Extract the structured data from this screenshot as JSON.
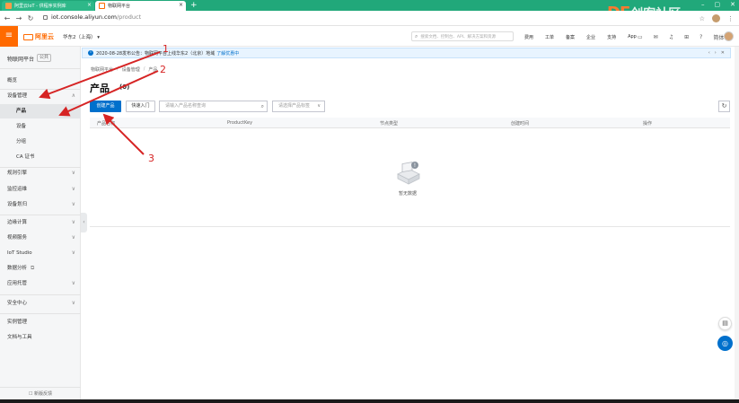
{
  "browser": {
    "tabs": [
      {
        "label": "阿里云IoT - 供程序实例库",
        "active": false
      },
      {
        "label": "物联网平台",
        "active": true
      }
    ],
    "new_tab": "+",
    "url_host": "iot.console.aliyun.com",
    "url_path": "/product"
  },
  "watermark": {
    "brand": "DF",
    "text": "创客社区"
  },
  "topbar": {
    "logo": "阿里云",
    "region": "华东2（上海）",
    "search_placeholder": "搜索文档、控制台、API、解决方案和资源",
    "nav": [
      "费用",
      "工单",
      "备案",
      "企业",
      "支持",
      "App"
    ],
    "user": "简体"
  },
  "sidebar": {
    "title": "物联网平台",
    "badge": "公共",
    "items": [
      {
        "label": "概览",
        "chevron": ""
      },
      {
        "label": "设备管理",
        "chevron": "∧"
      },
      {
        "label": "产品",
        "chevron": ""
      },
      {
        "label": "设备",
        "chevron": ""
      },
      {
        "label": "分组",
        "chevron": ""
      },
      {
        "label": "CA 证书",
        "chevron": ""
      },
      {
        "label": "规则引擎",
        "chevron": "∨"
      },
      {
        "label": "监控运维",
        "chevron": "∨"
      },
      {
        "label": "设备划归",
        "chevron": "∨"
      },
      {
        "label": "边缘计算",
        "chevron": "∨"
      },
      {
        "label": "视频服务",
        "chevron": "∨"
      },
      {
        "label": "IoT Studio",
        "chevron": "∨"
      },
      {
        "label": "数据分析",
        "chevron": "⧉"
      },
      {
        "label": "应用托管",
        "chevron": "∨"
      },
      {
        "label": "安全中心",
        "chevron": "∨"
      },
      {
        "label": "实例管理",
        "chevron": ""
      },
      {
        "label": "文档与工具",
        "chevron": ""
      }
    ],
    "footer": "新版反馈"
  },
  "notice": {
    "text": "2020-08-28发布公告：物联网平台上线华东2（北京）地域",
    "link": "了解优惠中"
  },
  "breadcrumb": [
    "物联网平台",
    "设备管理",
    "产品"
  ],
  "page": {
    "title": "产品",
    "count": "(0)"
  },
  "toolbar": {
    "create": "创建产品",
    "quick_start": "快速入门",
    "search_placeholder": "请输入产品名称查询",
    "select_placeholder": "请选择产品标签"
  },
  "table": {
    "columns": [
      "产品名称",
      "ProductKey",
      "节点类型",
      "创建时间",
      "操作"
    ],
    "empty": "暂无数据"
  },
  "annotations": [
    "1",
    "2",
    "3"
  ],
  "colors": {
    "accent": "#0070cc",
    "brand": "#ff6a00",
    "tabbar": "#21a87a",
    "arrow": "#d62424"
  }
}
